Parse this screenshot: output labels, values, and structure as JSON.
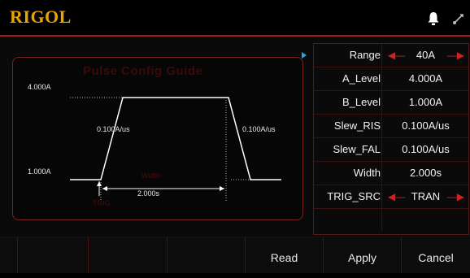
{
  "header": {
    "logo": "RIGOL",
    "icons": [
      "bell-icon",
      "usb-icon"
    ]
  },
  "guide": {
    "title": "Pulse Config Guide",
    "labels": {
      "high_level": "4.000A",
      "low_level": "1.000A",
      "rise_slew": "0.100A/us",
      "fall_slew": "0.100A/us",
      "width_label": "Width",
      "width_value": "2.000s",
      "trig": "TRIG"
    }
  },
  "params": [
    {
      "label": "Range",
      "value": "40A",
      "arrows": true
    },
    {
      "label": "A_Level",
      "value": "4.000A",
      "arrows": false
    },
    {
      "label": "B_Level",
      "value": "1.000A",
      "arrows": false
    },
    {
      "label": "Slew_RIS",
      "value": "0.100A/us",
      "arrows": false
    },
    {
      "label": "Slew_FAL",
      "value": "0.100A/us",
      "arrows": false
    },
    {
      "label": "Width",
      "value": "2.000s",
      "arrows": false
    },
    {
      "label": "TRIG_SRC",
      "value": "TRAN",
      "arrows": true
    },
    {
      "label": "",
      "value": "",
      "arrows": false
    }
  ],
  "softkeys": [
    "",
    "",
    "",
    "",
    "Read",
    "Apply",
    "Cancel"
  ],
  "colors": {
    "accent": "#b01818",
    "logo": "#e8a400",
    "selector": "#22aadd"
  }
}
